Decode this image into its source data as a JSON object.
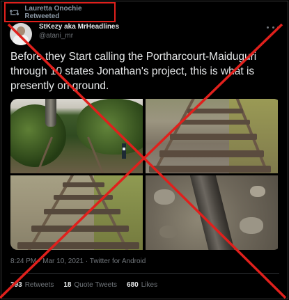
{
  "retweet_banner": {
    "label": "Lauretta Onochie Retweeted",
    "icon": "retweet-icon"
  },
  "author": {
    "display_name": "StKezy aka MrHeadlines",
    "handle": "@atani_mr"
  },
  "tweet": {
    "text": "Before they Start calling the Portharcourt-Maiduguri through 10 states Jonathan's project, this is what is presently on ground.",
    "timestamp": "8:24 PM · Mar 10, 2021 · Twitter for Android"
  },
  "stats": [
    {
      "value": "393",
      "label": "Retweets"
    },
    {
      "value": "18",
      "label": "Quote Tweets"
    },
    {
      "value": "680",
      "label": "Likes"
    }
  ],
  "colors": {
    "highlight_box": "#e0201c",
    "cross": "#e0201c",
    "background": "#000000",
    "text": "#e7e9ea",
    "muted": "#71767b"
  }
}
